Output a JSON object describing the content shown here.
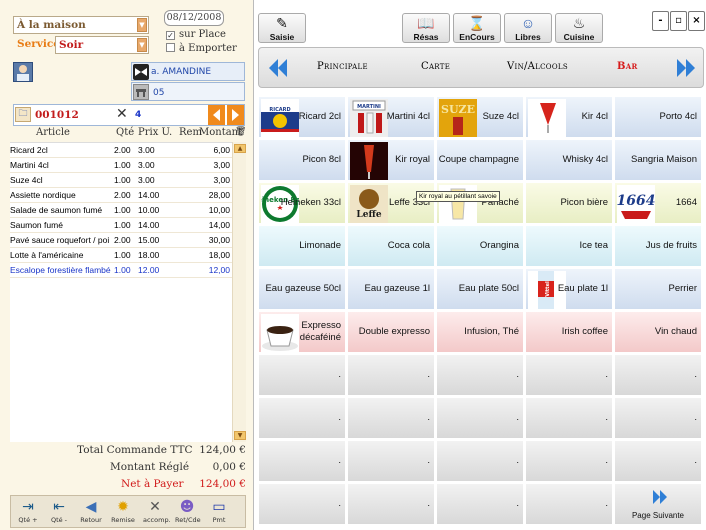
{
  "order": {
    "location": "À la maison",
    "date": "08/12/2008",
    "service_label": "Service",
    "service_value": "Soir",
    "sur_place": "sur Place",
    "a_emporter": "à Emporter",
    "waiter": "a. AMANDINE",
    "table_no": "05",
    "order_no": "001012",
    "covers": "4"
  },
  "table": {
    "headers": [
      "Article",
      "Qté",
      "Prix U.",
      "Rem",
      "Montant"
    ],
    "rows": [
      [
        "Ricard 2cl",
        "2.00",
        "3.00",
        "",
        "6,00"
      ],
      [
        "Martini 4cl",
        "1.00",
        "3.00",
        "",
        "3,00"
      ],
      [
        "Suze 4cl",
        "1.00",
        "3.00",
        "",
        "3,00"
      ],
      [
        "Assiette nordique",
        "2.00",
        "14.00",
        "",
        "28,00"
      ],
      [
        "Salade de saumon fumé",
        "1.00",
        "10.00",
        "",
        "10,00"
      ],
      [
        "Saumon fumé",
        "1.00",
        "14.00",
        "",
        "14,00"
      ],
      [
        "Pavé sauce roquefort / poi",
        "2.00",
        "15.00",
        "",
        "30,00"
      ],
      [
        "Lotte à l'américaine",
        "1.00",
        "18.00",
        "",
        "18,00"
      ],
      [
        "Escalope forestière flambé",
        "1.00",
        "12.00",
        "",
        "12,00"
      ]
    ]
  },
  "totals": {
    "total_label": "Total Commande TTC",
    "total_value": "124,00 €",
    "paid_label": "Montant Réglé",
    "paid_value": "0,00 €",
    "due_label": "Net à Payer",
    "due_value": "124,00 €"
  },
  "toolbar": [
    "Qté +",
    "Qté -",
    "Retour",
    "Remise",
    "accomp.",
    "Ret/Cde",
    "Pmt"
  ],
  "top_buttons": [
    "Saisie",
    "Résas",
    "EnCours",
    "Libres",
    "Cuisine"
  ],
  "window_buttons": [
    "-",
    "▫",
    "×"
  ],
  "tabs": [
    "Principale",
    "Carte",
    "Vin/Alcools",
    "Bar"
  ],
  "products": [
    [
      "Ricard 2cl",
      "Martini 4cl",
      "Suze 4cl",
      "Kir 4cl",
      "Porto 4cl"
    ],
    [
      "Picon 8cl",
      "Kir royal",
      "Coupe champagne",
      "Whisky 4cl",
      "Sangria Maison"
    ],
    [
      "Heineken 33cl",
      "Leffe 33cl",
      "Panaché",
      "Picon bière",
      "1664"
    ],
    [
      "Limonade",
      "Coca cola",
      "Orangina",
      "Ice tea",
      "Jus de fruits"
    ],
    [
      "Eau gazeuse 50cl",
      "Eau gazeuse 1l",
      "Eau plate 50cl",
      "Eau plate 1l",
      "Perrier"
    ],
    [
      "Expresso décaféiné",
      "Double expresso",
      "Infusion, Thé",
      "Irish coffee",
      "Vin chaud"
    ]
  ],
  "empty_cell": ".",
  "next_page": "Page Suivante",
  "tooltip": "Kir royal au pétillant savoie",
  "logos": {
    "ricard": "RICARD",
    "martini": "MARTINI",
    "suze": "SUZE",
    "heineken": "Heineken Beer",
    "leffe": "Leffe",
    "kronenbourg": "1664",
    "vittel": "Vittel"
  }
}
